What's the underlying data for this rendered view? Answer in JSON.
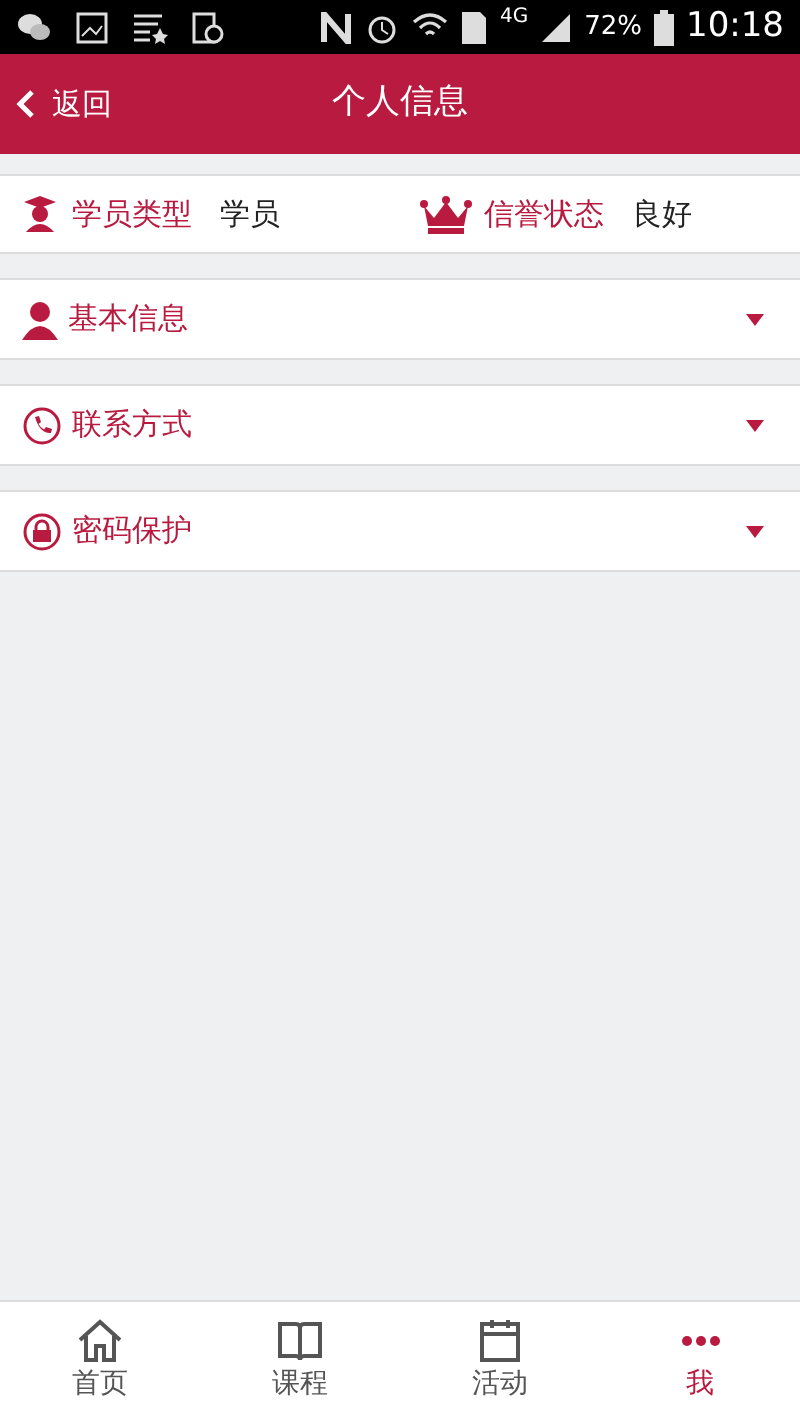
{
  "status_bar": {
    "network": "4G",
    "battery": "72%",
    "time": "10:18"
  },
  "header": {
    "back": "返回",
    "title": "个人信息"
  },
  "info": [
    {
      "kind": "type",
      "label": "学员类型",
      "value": "学员"
    },
    {
      "kind": "credit",
      "label": "信誉状态",
      "value": "良好"
    }
  ],
  "sections": [
    {
      "kind": "person",
      "label": "基本信息",
      "expanded": false
    },
    {
      "kind": "phone",
      "label": "联系方式",
      "expanded": false
    },
    {
      "kind": "lock",
      "label": "密码保护",
      "expanded": false
    }
  ],
  "tabs": [
    {
      "kind": "home",
      "label": "首页",
      "selected": false
    },
    {
      "kind": "course",
      "label": "课程",
      "selected": false
    },
    {
      "kind": "event",
      "label": "活动",
      "selected": false
    },
    {
      "kind": "me",
      "label": "我",
      "selected": true
    }
  ]
}
